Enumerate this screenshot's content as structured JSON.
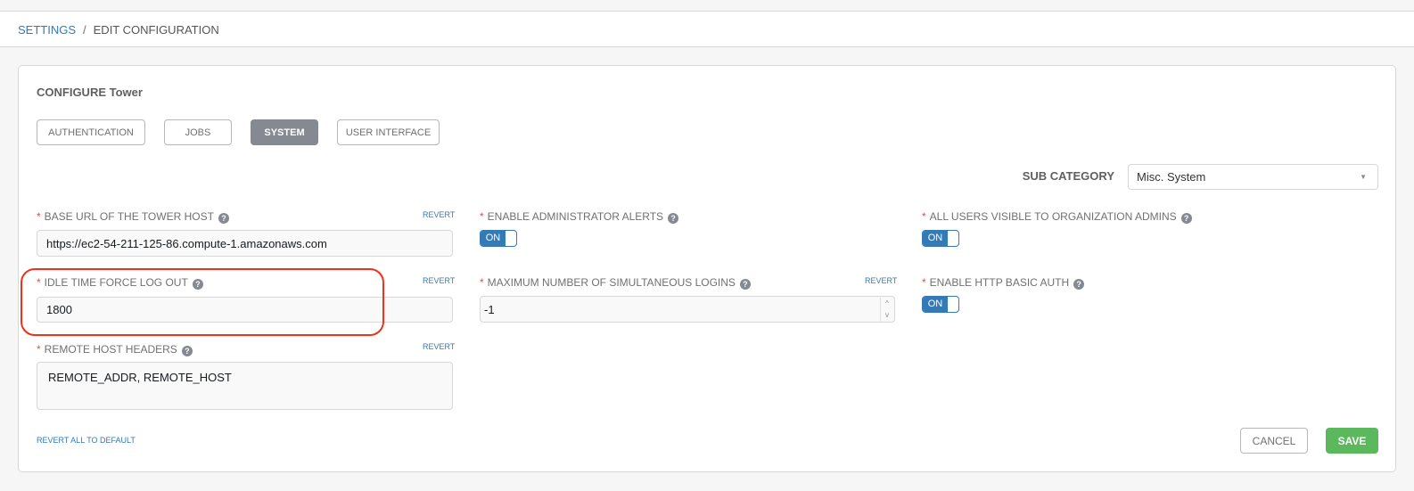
{
  "breadcrumb": {
    "settings": "SETTINGS",
    "separator": "/",
    "current": "EDIT CONFIGURATION"
  },
  "panel": {
    "title": "CONFIGURE Tower"
  },
  "tabs": [
    {
      "label": "AUTHENTICATION"
    },
    {
      "label": "JOBS"
    },
    {
      "label": "SYSTEM",
      "active": true
    },
    {
      "label": "USER INTERFACE"
    }
  ],
  "sub_category": {
    "label": "SUB CATEGORY",
    "value": "Misc. System"
  },
  "fields": {
    "base_url": {
      "label": "BASE URL OF THE TOWER HOST",
      "value": "https://ec2-54-211-125-86.compute-1.amazonaws.com",
      "revert": "REVERT"
    },
    "idle_time": {
      "label": "IDLE TIME FORCE LOG OUT",
      "value": "1800",
      "revert": "REVERT"
    },
    "remote_host_headers": {
      "label": "REMOTE HOST HEADERS",
      "value": "REMOTE_ADDR, REMOTE_HOST",
      "revert": "REVERT"
    },
    "admin_alerts": {
      "label": "ENABLE ADMINISTRATOR ALERTS",
      "value": "ON"
    },
    "max_logins": {
      "label": "MAXIMUM NUMBER OF SIMULTANEOUS LOGINS",
      "value": "-1",
      "revert": "REVERT"
    },
    "users_visible": {
      "label": "ALL USERS VISIBLE TO ORGANIZATION ADMINS",
      "value": "ON"
    },
    "http_basic_auth": {
      "label": "ENABLE HTTP BASIC AUTH",
      "value": "ON"
    }
  },
  "required_mark": "*",
  "help_glyph": "?",
  "actions": {
    "revert_all": "REVERT ALL TO DEFAULT",
    "cancel": "CANCEL",
    "save": "SAVE"
  },
  "colors": {
    "link": "#337ab7",
    "save": "#5cb85c",
    "active_tab": "#848992",
    "highlight": "#f0321a",
    "required": "#d9534f"
  }
}
